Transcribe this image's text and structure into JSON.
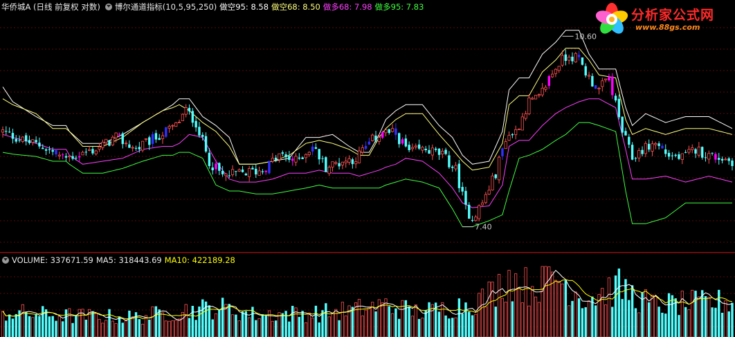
{
  "colors": {
    "background": "#000000",
    "grid": "#5a0a0a",
    "separator": "#8a1010",
    "up_candle": "#ff5252",
    "down_candle": "#54ffff",
    "highlight_candle_magenta": "#ff00ff",
    "highlight_candle_blue": "#3030ff",
    "line_kong95": "#ffffff",
    "line_kong68": "#ffff80",
    "line_duo68": "#ff40ff",
    "line_duo95": "#40ff40",
    "volume_up": "#ff5252",
    "volume_down": "#54ffff",
    "ma5": "#ffffff",
    "ma10": "#ffff00"
  },
  "header": {
    "stock": "华侨城A (日线 前复权 对数)",
    "indicator": "博尔通道指标(10,5,95,250)",
    "kong95_label": "做空95: 8.58",
    "kong68_label": "做空68: 8.50",
    "duo68_label": "做多68: 7.98",
    "duo95_label": "做多95: 7.83"
  },
  "volume_header": {
    "volume_label": "VOLUME: 337671.59",
    "ma5_label": "MA5: 318443.69",
    "ma10_label": "MA10: 422189.28"
  },
  "logo": {
    "text": "分析家公式网",
    "url": "www.88gs.com",
    "icon": "flower-icon"
  },
  "chart_data": {
    "type": "candlestick",
    "panels": [
      "price",
      "volume"
    ],
    "annotations": [
      {
        "text": "7.40",
        "kind": "low"
      },
      {
        "text": "10.60",
        "kind": "high"
      }
    ],
    "price_anchors": {
      "low": 7.4,
      "high": 10.6
    },
    "price_ylim": [
      7.0,
      11.0
    ],
    "bands": {
      "kong95": [
        [
          0,
          9.75
        ],
        [
          3,
          9.5
        ],
        [
          10,
          9.25
        ],
        [
          15,
          9.1
        ],
        [
          19,
          9.1
        ],
        [
          20,
          9.0
        ],
        [
          24,
          8.8
        ],
        [
          30,
          8.8
        ],
        [
          36,
          8.95
        ],
        [
          42,
          9.15
        ],
        [
          48,
          9.35
        ],
        [
          51,
          9.45
        ],
        [
          53,
          9.55
        ],
        [
          56,
          9.55
        ],
        [
          60,
          9.25
        ],
        [
          64,
          9.1
        ],
        [
          68,
          8.9
        ],
        [
          71,
          8.45
        ],
        [
          76,
          8.45
        ],
        [
          81,
          8.5
        ],
        [
          86,
          8.55
        ],
        [
          91,
          8.9
        ],
        [
          95,
          8.9
        ],
        [
          99,
          8.95
        ],
        [
          104,
          8.75
        ],
        [
          107,
          8.65
        ],
        [
          110,
          8.65
        ],
        [
          113,
          8.95
        ],
        [
          115,
          9.2
        ],
        [
          118,
          9.35
        ],
        [
          121,
          9.45
        ],
        [
          126,
          9.45
        ],
        [
          131,
          9.1
        ],
        [
          135,
          8.9
        ],
        [
          138,
          8.6
        ],
        [
          141,
          8.45
        ],
        [
          146,
          8.5
        ],
        [
          150,
          9.0
        ],
        [
          152,
          9.7
        ],
        [
          155,
          9.9
        ],
        [
          158,
          9.9
        ],
        [
          162,
          10.3
        ],
        [
          166,
          10.5
        ],
        [
          169,
          10.7
        ],
        [
          173,
          10.7
        ],
        [
          176,
          10.3
        ],
        [
          179,
          10.05
        ],
        [
          184,
          10.05
        ],
        [
          187,
          9.4
        ],
        [
          189,
          9.1
        ],
        [
          193,
          9.3
        ],
        [
          199,
          9.15
        ],
        [
          205,
          9.25
        ],
        [
          212,
          9.25
        ],
        [
          219,
          9.05
        ]
      ],
      "kong68": [
        [
          0,
          9.55
        ],
        [
          3,
          9.45
        ],
        [
          10,
          9.3
        ],
        [
          15,
          9.05
        ],
        [
          19,
          9.05
        ],
        [
          20,
          9.0
        ],
        [
          24,
          8.75
        ],
        [
          30,
          8.75
        ],
        [
          36,
          8.9
        ],
        [
          42,
          9.15
        ],
        [
          48,
          9.35
        ],
        [
          51,
          9.4
        ],
        [
          53,
          9.45
        ],
        [
          56,
          9.35
        ],
        [
          60,
          9.15
        ],
        [
          64,
          9.0
        ],
        [
          68,
          8.75
        ],
        [
          71,
          8.45
        ],
        [
          76,
          8.45
        ],
        [
          81,
          8.5
        ],
        [
          86,
          8.6
        ],
        [
          91,
          8.8
        ],
        [
          95,
          8.85
        ],
        [
          99,
          8.8
        ],
        [
          104,
          8.7
        ],
        [
          107,
          8.6
        ],
        [
          110,
          8.6
        ],
        [
          113,
          8.9
        ],
        [
          115,
          9.05
        ],
        [
          118,
          9.2
        ],
        [
          121,
          9.3
        ],
        [
          126,
          9.3
        ],
        [
          131,
          8.95
        ],
        [
          135,
          8.7
        ],
        [
          138,
          8.5
        ],
        [
          141,
          8.35
        ],
        [
          146,
          8.4
        ],
        [
          150,
          8.8
        ],
        [
          152,
          9.45
        ],
        [
          155,
          9.6
        ],
        [
          158,
          9.6
        ],
        [
          162,
          10.0
        ],
        [
          166,
          10.2
        ],
        [
          169,
          10.4
        ],
        [
          173,
          10.4
        ],
        [
          176,
          10.2
        ],
        [
          179,
          9.95
        ],
        [
          184,
          9.9
        ],
        [
          187,
          9.2
        ],
        [
          189,
          8.95
        ],
        [
          193,
          9.05
        ],
        [
          199,
          8.95
        ],
        [
          205,
          9.05
        ],
        [
          212,
          9.05
        ],
        [
          219,
          8.95
        ]
      ],
      "duo68": [
        [
          0,
          8.95
        ],
        [
          3,
          8.9
        ],
        [
          10,
          8.8
        ],
        [
          15,
          8.7
        ],
        [
          19,
          8.7
        ],
        [
          20,
          8.6
        ],
        [
          24,
          8.45
        ],
        [
          30,
          8.5
        ],
        [
          36,
          8.55
        ],
        [
          42,
          8.7
        ],
        [
          48,
          8.75
        ],
        [
          51,
          8.75
        ],
        [
          53,
          8.8
        ],
        [
          56,
          8.95
        ],
        [
          60,
          8.9
        ],
        [
          64,
          8.5
        ],
        [
          68,
          8.2
        ],
        [
          71,
          8.15
        ],
        [
          76,
          8.15
        ],
        [
          81,
          8.2
        ],
        [
          86,
          8.3
        ],
        [
          91,
          8.3
        ],
        [
          95,
          8.35
        ],
        [
          99,
          8.3
        ],
        [
          104,
          8.3
        ],
        [
          107,
          8.25
        ],
        [
          110,
          8.3
        ],
        [
          113,
          8.35
        ],
        [
          115,
          8.4
        ],
        [
          118,
          8.45
        ],
        [
          121,
          8.55
        ],
        [
          126,
          8.5
        ],
        [
          131,
          8.3
        ],
        [
          135,
          8.05
        ],
        [
          138,
          7.8
        ],
        [
          141,
          7.72
        ],
        [
          146,
          7.75
        ],
        [
          150,
          8.1
        ],
        [
          152,
          8.75
        ],
        [
          155,
          8.85
        ],
        [
          158,
          8.85
        ],
        [
          162,
          9.1
        ],
        [
          166,
          9.3
        ],
        [
          169,
          9.4
        ],
        [
          173,
          9.5
        ],
        [
          176,
          9.55
        ],
        [
          179,
          9.55
        ],
        [
          184,
          9.4
        ],
        [
          187,
          8.7
        ],
        [
          189,
          8.2
        ],
        [
          193,
          8.2
        ],
        [
          199,
          8.25
        ],
        [
          205,
          8.15
        ],
        [
          212,
          8.25
        ],
        [
          219,
          8.15
        ]
      ],
      "duo95": [
        [
          0,
          8.65
        ],
        [
          3,
          8.62
        ],
        [
          10,
          8.58
        ],
        [
          15,
          8.5
        ],
        [
          19,
          8.5
        ],
        [
          20,
          8.45
        ],
        [
          24,
          8.3
        ],
        [
          30,
          8.3
        ],
        [
          36,
          8.38
        ],
        [
          42,
          8.5
        ],
        [
          48,
          8.6
        ],
        [
          51,
          8.6
        ],
        [
          53,
          8.65
        ],
        [
          56,
          8.65
        ],
        [
          60,
          8.55
        ],
        [
          64,
          8.1
        ],
        [
          68,
          8.0
        ],
        [
          71,
          8.0
        ],
        [
          76,
          7.95
        ],
        [
          81,
          7.95
        ],
        [
          86,
          8.0
        ],
        [
          91,
          8.05
        ],
        [
          95,
          8.1
        ],
        [
          99,
          8.05
        ],
        [
          104,
          8.05
        ],
        [
          107,
          8.05
        ],
        [
          110,
          8.05
        ],
        [
          113,
          8.05
        ],
        [
          115,
          8.1
        ],
        [
          118,
          8.15
        ],
        [
          121,
          8.2
        ],
        [
          126,
          8.15
        ],
        [
          131,
          8.05
        ],
        [
          135,
          7.7
        ],
        [
          138,
          7.4
        ],
        [
          141,
          7.4
        ],
        [
          146,
          7.5
        ],
        [
          150,
          7.6
        ],
        [
          152,
          8.0
        ],
        [
          155,
          8.55
        ],
        [
          158,
          8.6
        ],
        [
          162,
          8.7
        ],
        [
          166,
          8.85
        ],
        [
          169,
          8.95
        ],
        [
          173,
          9.15
        ],
        [
          176,
          9.15
        ],
        [
          179,
          9.1
        ],
        [
          184,
          9.0
        ],
        [
          187,
          8.0
        ],
        [
          189,
          7.45
        ],
        [
          193,
          7.45
        ],
        [
          199,
          7.55
        ],
        [
          205,
          7.8
        ],
        [
          212,
          7.8
        ],
        [
          219,
          7.8
        ]
      ]
    },
    "path_anchors": [
      [
        0,
        9.0
      ],
      [
        6,
        8.85
      ],
      [
        12,
        8.75
      ],
      [
        18,
        8.55
      ],
      [
        22,
        8.6
      ],
      [
        28,
        8.7
      ],
      [
        34,
        8.9
      ],
      [
        40,
        8.7
      ],
      [
        46,
        8.9
      ],
      [
        52,
        9.1
      ],
      [
        55,
        9.35
      ],
      [
        58,
        9.15
      ],
      [
        62,
        8.5
      ],
      [
        66,
        8.25
      ],
      [
        72,
        8.3
      ],
      [
        78,
        8.35
      ],
      [
        83,
        8.6
      ],
      [
        88,
        8.5
      ],
      [
        93,
        8.75
      ],
      [
        97,
        8.4
      ],
      [
        102,
        8.5
      ],
      [
        106,
        8.55
      ],
      [
        110,
        8.8
      ],
      [
        114,
        9.0
      ],
      [
        118,
        8.95
      ],
      [
        122,
        8.65
      ],
      [
        127,
        8.7
      ],
      [
        132,
        8.6
      ],
      [
        136,
        8.35
      ],
      [
        139,
        7.7
      ],
      [
        141,
        7.55
      ],
      [
        144,
        7.8
      ],
      [
        148,
        8.3
      ],
      [
        151,
        8.9
      ],
      [
        154,
        9.0
      ],
      [
        158,
        9.5
      ],
      [
        161,
        9.55
      ],
      [
        164,
        9.9
      ],
      [
        167,
        10.15
      ],
      [
        170,
        10.3
      ],
      [
        173,
        10.2
      ],
      [
        176,
        9.9
      ],
      [
        179,
        9.7
      ],
      [
        182,
        9.9
      ],
      [
        184,
        9.45
      ],
      [
        186,
        9.0
      ],
      [
        189,
        8.55
      ],
      [
        192,
        8.7
      ],
      [
        196,
        8.8
      ],
      [
        200,
        8.6
      ],
      [
        204,
        8.55
      ],
      [
        208,
        8.7
      ],
      [
        212,
        8.6
      ],
      [
        216,
        8.55
      ],
      [
        219,
        8.5
      ]
    ],
    "vol_anchors": [
      [
        0,
        0.35
      ],
      [
        20,
        0.3
      ],
      [
        40,
        0.28
      ],
      [
        55,
        0.38
      ],
      [
        65,
        0.42
      ],
      [
        75,
        0.32
      ],
      [
        95,
        0.34
      ],
      [
        105,
        0.38
      ],
      [
        115,
        0.45
      ],
      [
        125,
        0.35
      ],
      [
        135,
        0.42
      ],
      [
        145,
        0.55
      ],
      [
        152,
        0.85
      ],
      [
        158,
        0.7
      ],
      [
        165,
        0.9
      ],
      [
        175,
        0.55
      ],
      [
        185,
        0.7
      ],
      [
        195,
        0.45
      ],
      [
        219,
        0.5
      ]
    ],
    "n_bars": 220
  }
}
